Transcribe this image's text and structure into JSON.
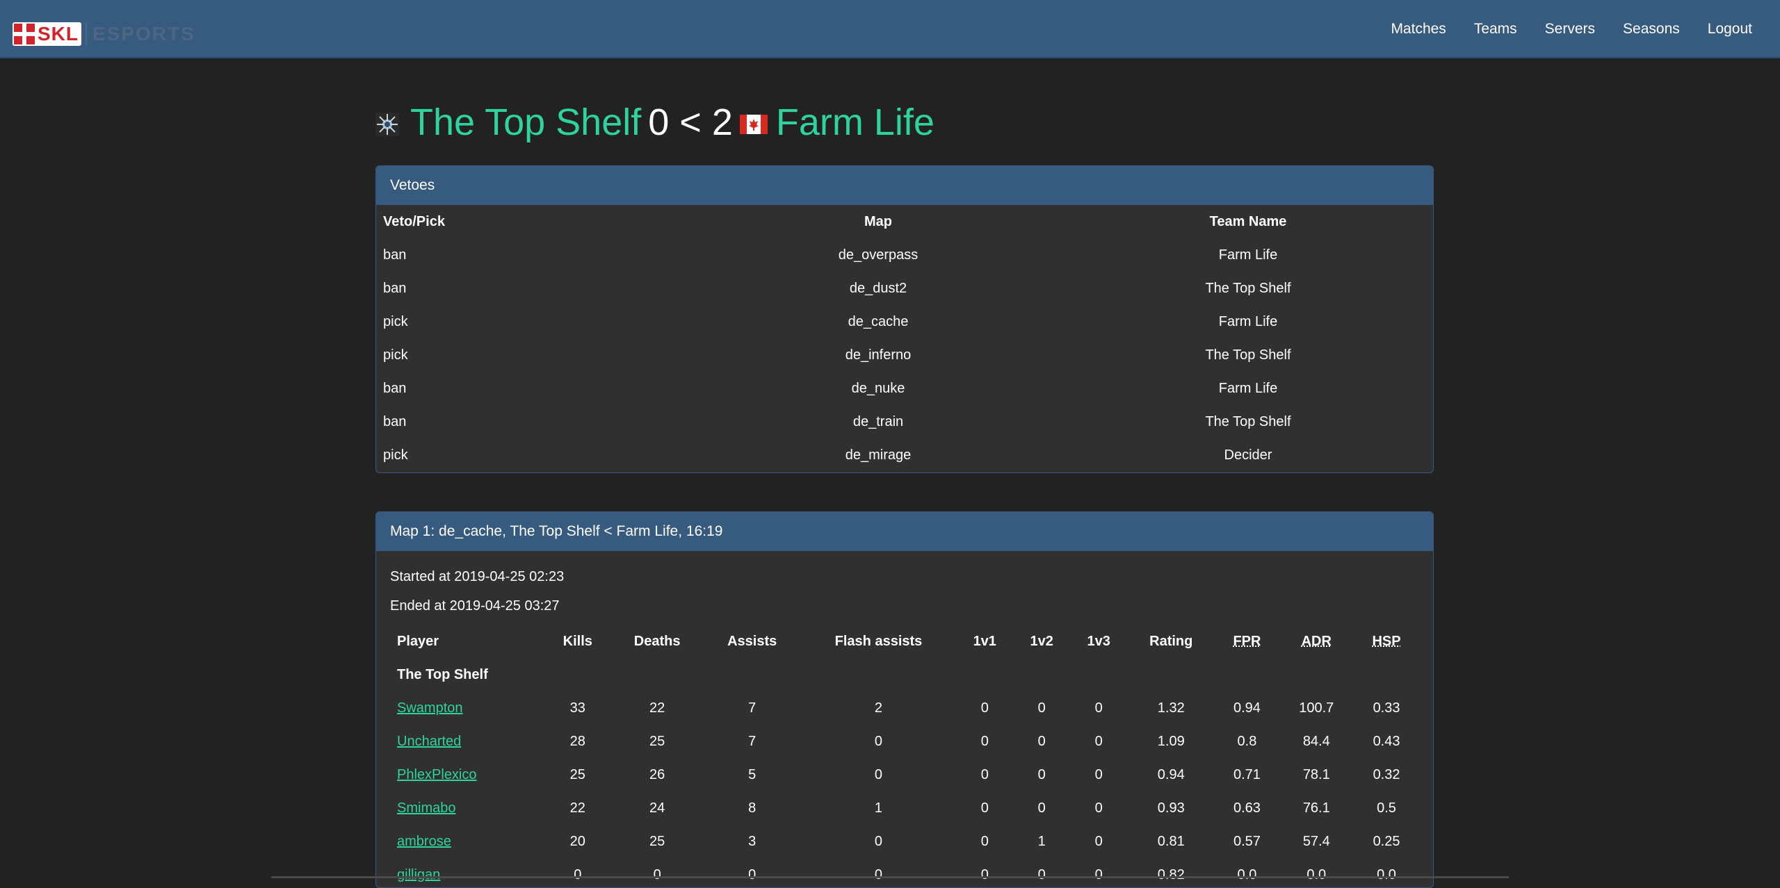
{
  "navbar": {
    "brand": "SKL",
    "brand_sub": "ESPORTS",
    "links": [
      "Matches",
      "Teams",
      "Servers",
      "Seasons",
      "Logout"
    ]
  },
  "match": {
    "team1": "The Top Shelf",
    "score1": "0",
    "comparator": "<",
    "score2": "2",
    "team2": "Farm Life",
    "team2_flag": "canada-flag"
  },
  "vetoes": {
    "header": "Vetoes",
    "columns": [
      "Veto/Pick",
      "Map",
      "Team Name"
    ],
    "rows": [
      [
        "ban",
        "de_overpass",
        "Farm Life"
      ],
      [
        "ban",
        "de_dust2",
        "The Top Shelf"
      ],
      [
        "pick",
        "de_cache",
        "Farm Life"
      ],
      [
        "pick",
        "de_inferno",
        "The Top Shelf"
      ],
      [
        "ban",
        "de_nuke",
        "Farm Life"
      ],
      [
        "ban",
        "de_train",
        "The Top Shelf"
      ],
      [
        "pick",
        "de_mirage",
        "Decider"
      ]
    ]
  },
  "map1": {
    "header": "Map 1: de_cache, The Top Shelf < Farm Life, 16:19",
    "started": "Started at 2019-04-25 02:23",
    "ended": "Ended at 2019-04-25 03:27",
    "columns": [
      "Player",
      "Kills",
      "Deaths",
      "Assists",
      "Flash assists",
      "1v1",
      "1v2",
      "1v3",
      "Rating",
      "FPR",
      "ADR",
      "HSP"
    ],
    "team_label": "The Top Shelf",
    "players": [
      [
        "Swampton",
        "33",
        "22",
        "7",
        "2",
        "0",
        "0",
        "0",
        "1.32",
        "0.94",
        "100.7",
        "0.33"
      ],
      [
        "Uncharted",
        "28",
        "25",
        "7",
        "0",
        "0",
        "0",
        "0",
        "1.09",
        "0.8",
        "84.4",
        "0.43"
      ],
      [
        "PhlexPlexico",
        "25",
        "26",
        "5",
        "0",
        "0",
        "0",
        "0",
        "0.94",
        "0.71",
        "78.1",
        "0.32"
      ],
      [
        "Smimabo",
        "22",
        "24",
        "8",
        "1",
        "0",
        "0",
        "0",
        "0.93",
        "0.63",
        "76.1",
        "0.5"
      ],
      [
        "ambrose",
        "20",
        "25",
        "3",
        "0",
        "0",
        "1",
        "0",
        "0.81",
        "0.57",
        "57.4",
        "0.25"
      ],
      [
        "gilligan",
        "0",
        "0",
        "0",
        "0",
        "0",
        "0",
        "0",
        "0.82",
        "0.0",
        "0.0",
        "0.0"
      ]
    ]
  },
  "colors": {
    "navbar": "#375a7f",
    "background": "#222222",
    "card": "#303030",
    "accent": "#2ed3a0"
  }
}
